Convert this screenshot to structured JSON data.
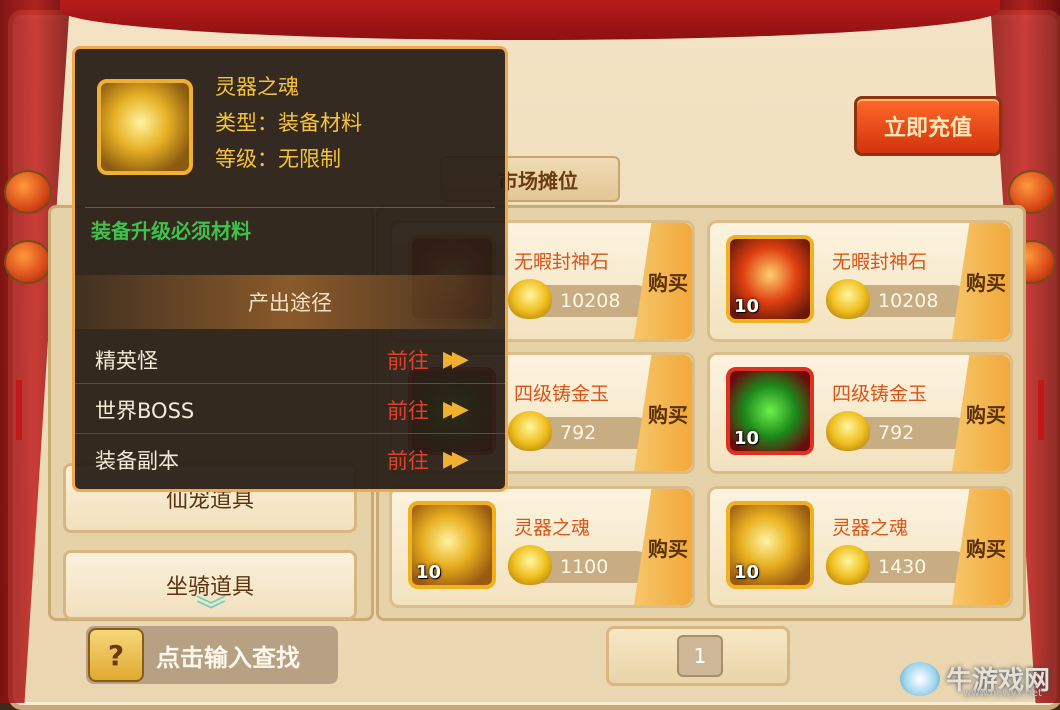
{
  "header": {
    "recharge_label": "立即充值",
    "title_partial": "市场摊位"
  },
  "categories": [
    {
      "label": "仙宠道具"
    },
    {
      "label": "坐骑道具"
    }
  ],
  "items": [
    {
      "name": "无暇封神石",
      "price": "10208",
      "buy_label": "购买",
      "qty": ""
    },
    {
      "name": "无暇封神石",
      "price": "10208",
      "buy_label": "购买",
      "qty": "10"
    },
    {
      "name": "四级铸金玉",
      "price": "792",
      "buy_label": "购买",
      "qty": ""
    },
    {
      "name": "四级铸金玉",
      "price": "792",
      "buy_label": "购买",
      "qty": "10"
    },
    {
      "name": "灵器之魂",
      "price": "1100",
      "buy_label": "购买",
      "qty": "10"
    },
    {
      "name": "灵器之魂",
      "price": "1430",
      "buy_label": "购买",
      "qty": "10"
    }
  ],
  "search": {
    "label": "点击输入查找"
  },
  "pager": {
    "page": "1"
  },
  "tooltip": {
    "name": "灵器之魂",
    "type": "类型：装备材料",
    "level": "等级：无限制",
    "desc": "装备升级必须材料",
    "source_header": "产出途径",
    "sources": [
      {
        "label": "精英怪",
        "go": "前往"
      },
      {
        "label": "世界BOSS",
        "go": "前往"
      },
      {
        "label": "装备副本",
        "go": "前往"
      }
    ]
  },
  "watermark": {
    "brand": "牛游戏网",
    "url": "www.newyx.net"
  },
  "colors": {
    "accent_gold": "#f6c33a",
    "go_red": "#e0402a",
    "desc_green": "#3ec24a",
    "recharge": "#d2320e"
  }
}
